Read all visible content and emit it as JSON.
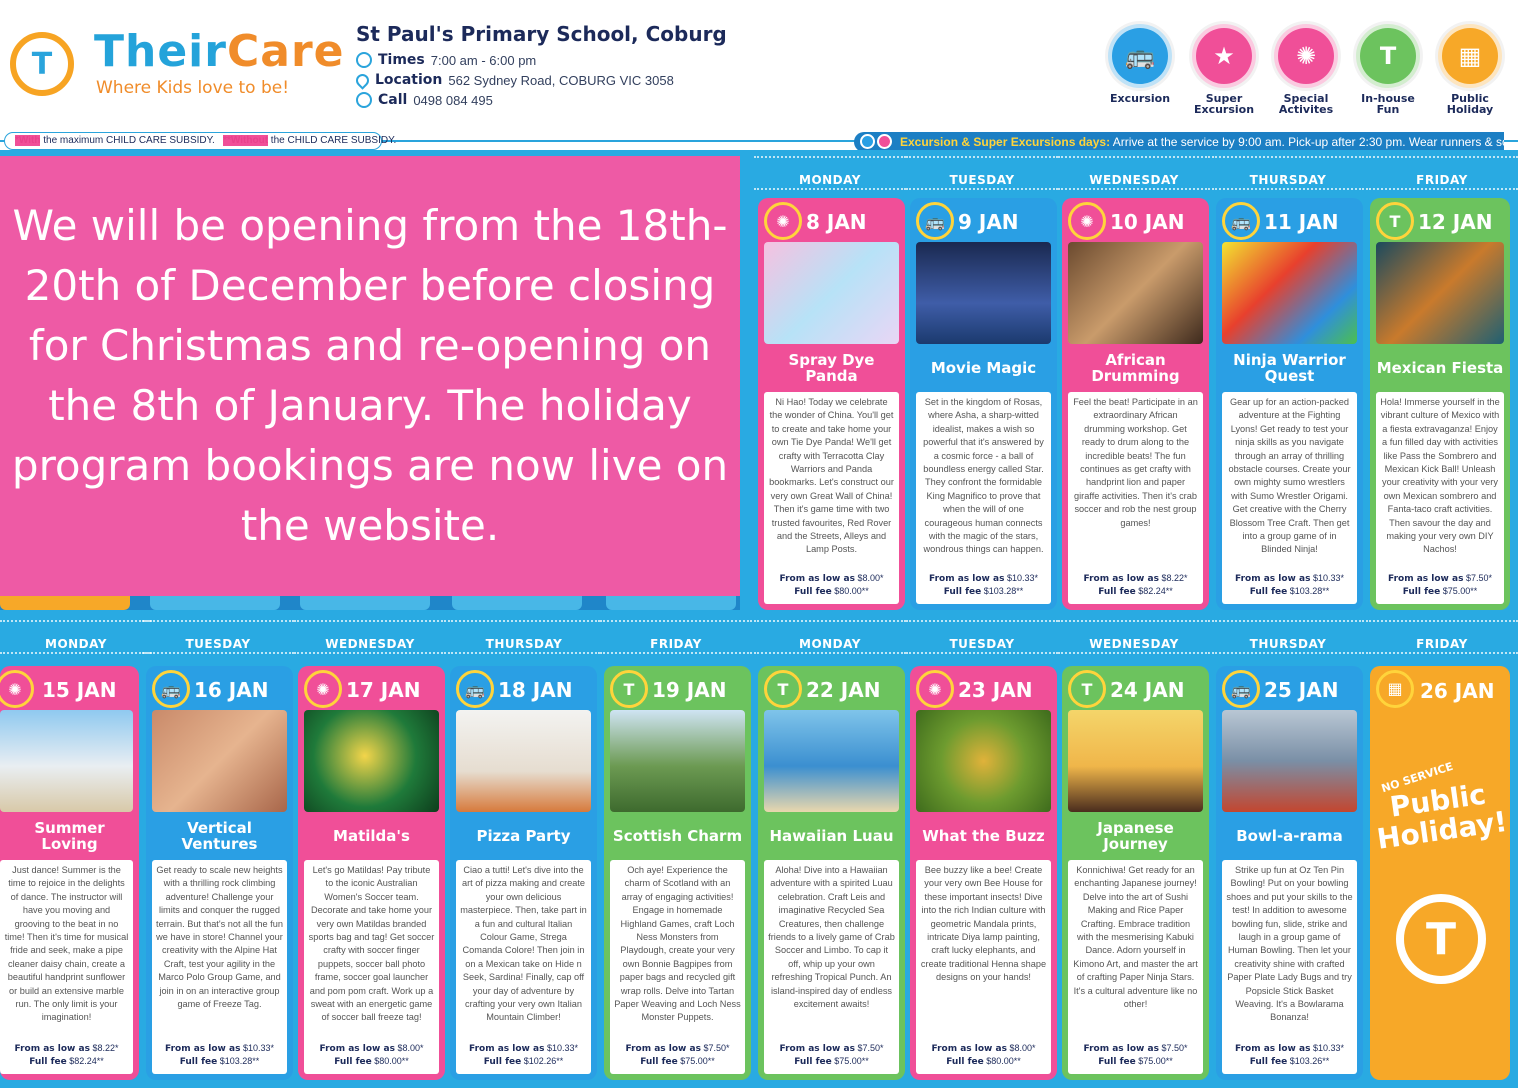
{
  "header": {
    "brand_their": "Their",
    "brand_care": "Care",
    "tagline": "Where Kids love to be!",
    "logo_letter": "T",
    "school": "St Paul's Primary School, Coburg",
    "times_label": "Times",
    "times_value": "7:00 am - 6:00 pm",
    "location_label": "Location",
    "location_value": "562 Sydney Road, COBURG VIC 3058",
    "call_label": "Call",
    "call_value": "0498 084 495"
  },
  "legend": [
    {
      "label": "Excursion",
      "color": "#2a9fe4",
      "glyph": "🚌"
    },
    {
      "label": "Super Excursion",
      "color": "#f04f98",
      "glyph": "★"
    },
    {
      "label": "Special Activites",
      "color": "#f04f98",
      "glyph": "✺"
    },
    {
      "label": "In-house Fun",
      "color": "#6cc35e",
      "glyph": "T"
    },
    {
      "label": "Public Holiday",
      "color": "#f7a828",
      "glyph": "▦"
    }
  ],
  "subsidy": {
    "with_star": "*With",
    "with_text": " the maximum CHILD CARE SUBSIDY.",
    "without_star": "**Without",
    "without_text": " the CHILD CARE SUBSIDY."
  },
  "excursion_note": {
    "highlight": "Excursion & Super Excursions days:",
    "text": " Arrive at the service by 9:00 am. Pick-up after 2:30 pm. Wear runners & socks."
  },
  "weekdays": [
    "MONDAY",
    "TUESDAY",
    "WEDNESDAY",
    "THURSDAY",
    "FRIDAY"
  ],
  "notice": "We will be opening from the 18th-20th of December before closing for Christmas and re-opening on the 8th of January. The holiday program bookings are now live on the website.",
  "price_label": "From as low as",
  "fee_label": "Full fee",
  "week1": [
    {
      "date": "8 JAN",
      "title": "Spray Dye Panda",
      "color": "pink",
      "glyph": "✺",
      "desc": "Ni Hao! Today we celebrate the wonder of China. You'll get to create and take home your own Tie Dye Panda! We'll get crafty with Terracotta Clay Warriors and Panda bookmarks. Let's construct our very own Great Wall of China! Then it's game time with two trusted favourites, Red Rover and the Streets, Alleys and Lamp Posts.",
      "low": "$8.00*",
      "full": "$80.00**"
    },
    {
      "date": "9 JAN",
      "title": "Movie Magic",
      "color": "blue",
      "glyph": "🚌",
      "desc": "Set in the kingdom of Rosas, where Asha, a sharp-witted idealist, makes a wish so powerful that it's answered by a cosmic force - a ball of boundless energy called Star. They confront the formidable King Magnifico to prove that when the will of one courageous human connects with the magic of the stars, wondrous things can happen.",
      "low": "$10.33*",
      "full": "$103.28**"
    },
    {
      "date": "10 JAN",
      "title": "African Drumming",
      "color": "pink",
      "glyph": "✺",
      "desc": "Feel the beat! Participate in an extraordinary African drumming workshop. Get ready to drum along to the incredible beats! The fun continues as get crafty with handprint lion and paper giraffe activities. Then it's crab soccer and rob the nest group games!",
      "low": "$8.22*",
      "full": "$82.24**"
    },
    {
      "date": "11 JAN",
      "title": "Ninja Warrior Quest",
      "color": "blue",
      "glyph": "🚌",
      "desc": "Gear up for an action-packed adventure at the Fighting Lyons! Get ready to test your ninja skills as you navigate through an array of thrilling obstacle courses. Create your own mighty sumo wrestlers with Sumo Wrestler Origami. Get creative with the Cherry Blossom Tree Craft. Then get into a group game of in Blinded Ninja!",
      "low": "$10.33*",
      "full": "$103.28**"
    },
    {
      "date": "12 JAN",
      "title": "Mexican Fiesta",
      "color": "green",
      "glyph": "T",
      "desc": "Hola! Immerse yourself in the vibrant culture of Mexico with a fiesta extravaganza! Enjoy a fun filled day with activities like Pass the Sombrero and Mexican Kick Ball! Unleash your creativity with your very own Mexican sombrero and Fanta-taco craft activities. Then savour the day and making your very own DIY Nachos!",
      "low": "$7.50*",
      "full": "$75.00**"
    }
  ],
  "week2": [
    {
      "date": "15 JAN",
      "title": "Summer Loving",
      "color": "pink",
      "glyph": "✺",
      "desc": "Just dance! Summer is the time to rejoice in the delights of dance. The instructor will have you moving and grooving to the beat in no time! Then it's time for musical fride and seek, make a pipe cleaner daisy chain, create a beautiful handprint sunflower or build an extensive marble run. The only limit is your imagination!",
      "low": "$8.22*",
      "full": "$82.24**"
    },
    {
      "date": "16 JAN",
      "title": "Vertical Ventures",
      "color": "blue",
      "glyph": "🚌",
      "desc": "Get ready to scale new heights with a thrilling rock climbing adventure! Challenge your limits and conquer the rugged terrain. But that's not all the fun we have in store! Channel your creativity with the Alpine Hat Craft, test your agility in the Marco Polo Group Game, and join in on an interactive group game of Freeze Tag.",
      "low": "$10.33*",
      "full": "$103.28**"
    },
    {
      "date": "17 JAN",
      "title": "Matilda's",
      "color": "pink",
      "glyph": "✺",
      "desc": "Let's go Matildas! Pay tribute to the iconic Australian Women's Soccer team. Decorate and take home your very own Matildas branded sports bag and tag! Get soccer crafty with soccer finger puppets, soccer ball photo frame, soccer goal launcher and pom pom craft. Work up a sweat with an energetic game of soccer ball freeze tag!",
      "low": "$8.00*",
      "full": "$80.00**"
    },
    {
      "date": "18 JAN",
      "title": "Pizza Party",
      "color": "blue",
      "glyph": "🚌",
      "desc": "Ciao a tutti! Let's dive into the art of pizza making and create your own delicious masterpiece. Then, take part in a fun and cultural Italian Colour Game, Strega Comanda Colore! Then join in on a Mexican take on Hide n Seek, Sardina! Finally, cap off your day of adventure by crafting your very own Italian Mountain Climber!",
      "low": "$10.33*",
      "full": "$102.26**"
    },
    {
      "date": "19 JAN",
      "title": "Scottish Charm",
      "color": "green",
      "glyph": "T",
      "desc": "Och aye! Experience the charm of Scotland with an array of engaging activities! Engage in homemade Highland Games, craft Loch Ness Monsters from Playdough, create your very own Bonnie Bagpipes from paper bags and recycled gift wrap rolls. Delve into Tartan Paper Weaving and Loch Ness Monster Puppets.",
      "low": "$7.50*",
      "full": "$75.00**"
    },
    {
      "date": "22 JAN",
      "title": "Hawaiian Luau",
      "color": "green",
      "glyph": "T",
      "desc": "Aloha! Dive into a Hawaiian adventure with a spirited Luau celebration. Craft Leis and imaginative Recycled Sea Creatures, then challenge friends to a lively game of Crab Soccer and Limbo. To cap it off, whip up your own refreshing Tropical Punch. An island-inspired day of endless excitement awaits!",
      "low": "$7.50*",
      "full": "$75.00**"
    },
    {
      "date": "23 JAN",
      "title": "What the Buzz",
      "color": "pink",
      "glyph": "✺",
      "desc": "Bee buzzy like a bee! Create your very own Bee House for these important insects! Dive into the rich Indian culture with geometric Mandala prints, intricate Diya lamp painting, craft lucky elephants, and create traditional Henna shape designs on your hands!",
      "low": "$8.00*",
      "full": "$80.00**"
    },
    {
      "date": "24 JAN",
      "title": "Japanese Journey",
      "color": "green",
      "glyph": "T",
      "desc": "Konnichiwa! Get ready for an enchanting Japanese journey! Delve into the art of Sushi Making and Rice Paper Crafting. Embrace tradition with the mesmerising Kabuki Dance. Adorn yourself in Kimono Art, and master the art of crafting Paper Ninja Stars. It's a cultural adventure like no other!",
      "low": "$7.50*",
      "full": "$75.00**"
    },
    {
      "date": "25 JAN",
      "title": "Bowl-a-rama",
      "color": "blue",
      "glyph": "🚌",
      "desc": "Strike up fun at Oz Ten Pin Bowling! Put on your bowling shoes and put your skills to the test! In addition to awesome bowling fun, slide, strike and laugh in a group game of Human Bowling. Then let your creativity shine with crafted Paper Plate Lady Bugs and try Popsicle Stick Basket Weaving. It's a Bowlarama Bonanza!",
      "low": "$10.33*",
      "full": "$103.26**"
    }
  ],
  "holiday": {
    "date": "26 JAN",
    "no_service": "NO SERVICE",
    "text": "Public Holiday!"
  }
}
